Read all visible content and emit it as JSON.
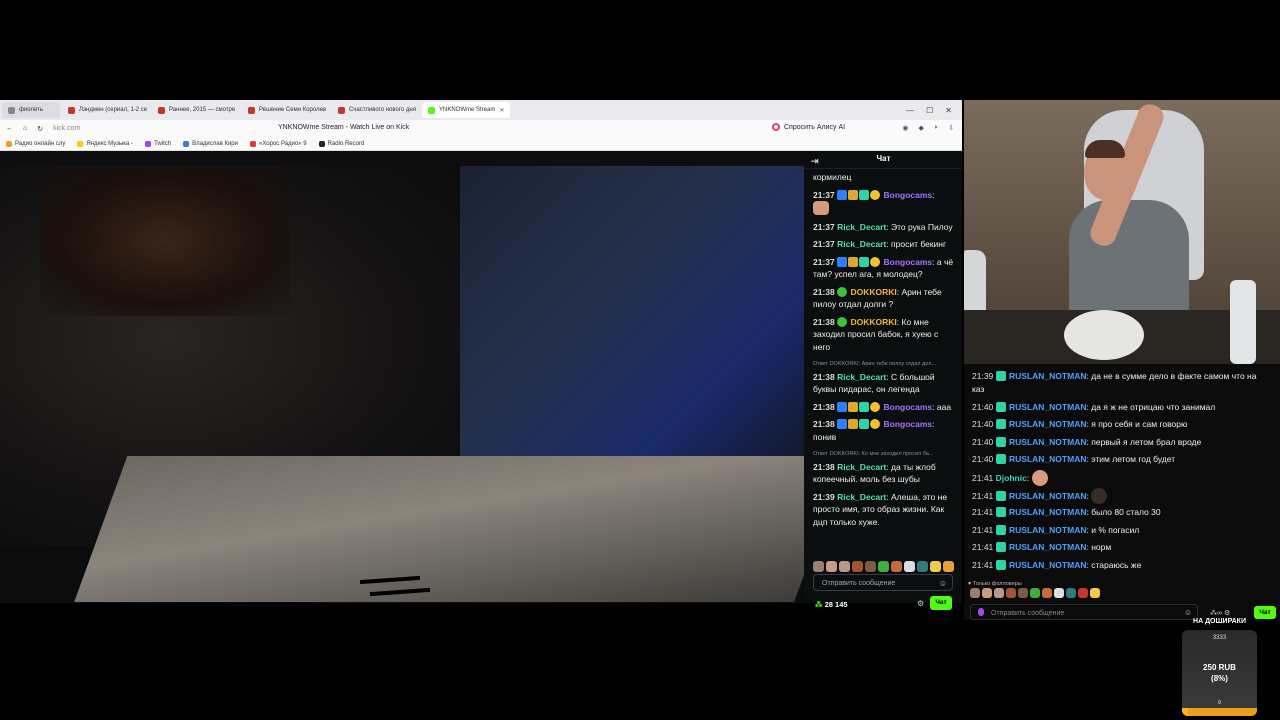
{
  "browser": {
    "tabs": [
      {
        "label": "фиолеть"
      },
      {
        "label": "Лэндмен (сериал, 1-2 се"
      },
      {
        "label": "Раннее, 2015 — смотре"
      },
      {
        "label": "Решение Семи Королев"
      },
      {
        "label": "Счастливого нового дня"
      },
      {
        "label": "YNKNOWme Stream"
      }
    ],
    "url": "kick.com",
    "page_title": "YNKNOWme Stream - Watch Live on Kick",
    "alice_label": "Спросить Алису AI",
    "bookmarks": [
      "Радио онлайн слу",
      "Яндекс Музыка -",
      "Twitch",
      "Владислав Кири",
      "«Хорос Радио» 9",
      "Radio Record"
    ]
  },
  "kick_chat": {
    "title": "Чат",
    "top_fragment": "кормилец",
    "messages": [
      {
        "time": "21:37",
        "user": "Bongocams",
        "sep": ":",
        "text": ""
      },
      {
        "time": "21:37",
        "user": "Rick_Decart",
        "sep": ":",
        "text": "Это рука Пилоу"
      },
      {
        "time": "21:37",
        "user": "Rick_Decart",
        "sep": ":",
        "text": "просит бекинг"
      },
      {
        "time": "21:37",
        "user": "Bongocams",
        "sep": ":",
        "text": "а чё там? успел ага, я молодец?"
      },
      {
        "time": "21:38",
        "user": "DOKKORKI",
        "sep": ":",
        "text": "Арин тебе пилоу отдал долги ?"
      },
      {
        "time": "21:38",
        "user": "DOKKORKI",
        "sep": ":",
        "text": "Ко мне заходил просил бабок, я хуею с него"
      },
      {
        "reply": "Ответ DOKKORKI: Арин тебе пилоу отдал дол...",
        "time": "21:38",
        "user": "Rick_Decart",
        "sep": ":",
        "text": "С большой буквы пидарас, он легенда"
      },
      {
        "time": "21:38",
        "user": "Bongocams",
        "sep": ":",
        "text": "ааа"
      },
      {
        "time": "21:38",
        "user": "Bongocams",
        "sep": ":",
        "text": "понив"
      },
      {
        "reply": "Ответ DOKKORKI: Ко мне заходил просил ба...",
        "time": "21:38",
        "user": "Rick_Decart",
        "sep": ":",
        "text": "да ты жлоб копеечный. моль без шубы"
      },
      {
        "time": "21:39",
        "user": "Rick_Decart",
        "sep": ":",
        "text": "Алеша, это не просто имя, это образ жизни. Как дцп только хуже."
      }
    ],
    "input_placeholder": "Отправить сообщение",
    "viewers": "28 145",
    "chat_button": "Чат"
  },
  "overlay_chat": {
    "messages": [
      {
        "time": "21:39",
        "user": "RUSLAN_NOTMAN",
        "sep": ":",
        "text": "да не в сумме дело в факте самом что на"
      },
      {
        "cont": "каз"
      },
      {
        "time": "21:40",
        "user": "RUSLAN_NOTMAN",
        "sep": ":",
        "text": "да я ж не отрицаю что занимал"
      },
      {
        "time": "21:40",
        "user": "RUSLAN_NOTMAN",
        "sep": ":",
        "text": "я про себя и сам говорю"
      },
      {
        "time": "21:40",
        "user": "RUSLAN_NOTMAN",
        "sep": ":",
        "text": "первый я летом брал вроде"
      },
      {
        "time": "21:40",
        "user": "RUSLAN_NOTMAN",
        "sep": ":",
        "text": "этим летом год будет"
      },
      {
        "time": "21:41",
        "user": "Djohnic",
        "sep": ":",
        "text": ""
      },
      {
        "time": "21:41",
        "user": "RUSLAN_NOTMAN",
        "sep": ":",
        "text": ""
      },
      {
        "time": "21:41",
        "user": "RUSLAN_NOTMAN",
        "sep": ":",
        "text": "было 80 стало 30"
      },
      {
        "time": "21:41",
        "user": "RUSLAN_NOTMAN",
        "sep": ":",
        "text": "и % погасил"
      },
      {
        "time": "21:41",
        "user": "RUSLAN_NOTMAN",
        "sep": ":",
        "text": "норм"
      },
      {
        "time": "21:41",
        "user": "RUSLAN_NOTMAN",
        "sep": ":",
        "text": "стараюсь же"
      }
    ],
    "followers_only": "♥ Только фолловеры",
    "input_placeholder": "Отправить сообщение",
    "chat_button": "Чат"
  },
  "goal": {
    "title": "НА ДОШИРАКИ",
    "target": "3333",
    "raised": "250 RUB",
    "percent_text": "(8%)",
    "progress_fraction": 0.08,
    "zero": "0"
  }
}
